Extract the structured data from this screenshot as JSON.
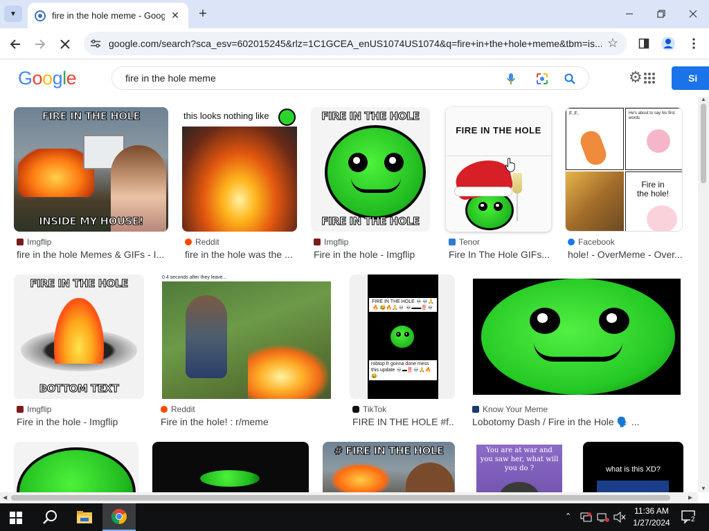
{
  "browser": {
    "tab_title": "fire in the hole meme - Google",
    "url": "google.com/search?sca_esv=602015245&rlz=1C1GCEA_enUS1074US1074&q=fire+in+the+hole+meme&tbm=is..."
  },
  "google": {
    "logo": "Google",
    "query": "fire in the hole meme",
    "signin_label": "Si"
  },
  "results": [
    {
      "source": "Imgflip",
      "title": "fire in the hole Memes & GIFs - I...",
      "top_text": "FIRE IN THE HOLE",
      "bottom_text": "INSIDE MY HOUSE!"
    },
    {
      "source": "Reddit",
      "title": "fire in the hole was the ...",
      "top_text": "this looks nothing like"
    },
    {
      "source": "Imgflip",
      "title": "Fire in the hole - Imgflip",
      "top_text": "FIRE IN THE HOLE",
      "bottom_text": "FIRE IN THE HOLE"
    },
    {
      "source": "Tenor",
      "title": "Fire In The Hole GIFs...",
      "top_text": "FIRE IN THE HOLE"
    },
    {
      "source": "Facebook",
      "title": "hole! - OverMeme - Over...",
      "panel_text": "Fire in the hole!",
      "panel_small_1": "F..F..",
      "panel_small_2": "He's about to say his first words"
    },
    {
      "source": "Imgflip",
      "title": "Fire in the hole - Imgflip",
      "top_text": "FIRE IN THE HOLE",
      "bottom_text": "BOTTOM TEXT"
    },
    {
      "source": "Reddit",
      "title": "Fire in the hole! : r/meme",
      "top_text": "0.4 seconds after they leave..."
    },
    {
      "source": "TikTok",
      "title": "FIRE IN THE HOLE #f...",
      "top_text": "FIRE IN THE HOLE 💀💀🙏🔥 😂🔥🙏💀 💀▬▬‼️💀",
      "bottom_text": "robtop fr gonna done mess this update 💀▬‼️💀🙏🔥😂"
    },
    {
      "source": "Know Your Meme",
      "title": "Lobotomy Dash / Fire in the Hole 🗣️ ..."
    },
    {
      "top_text": "# FIRE IN THE HOLE"
    },
    {
      "top_text": "You are at war and you saw her, what will you do ?"
    },
    {
      "top_text": "what is this XD?"
    }
  ],
  "taskbar": {
    "time": "11:36 AM",
    "date": "1/27/2024",
    "notifications": "2"
  },
  "colors": {
    "accent": "#1a73e8",
    "tabstrip": "#dbe5f7",
    "face_green": "#2ad42a"
  }
}
